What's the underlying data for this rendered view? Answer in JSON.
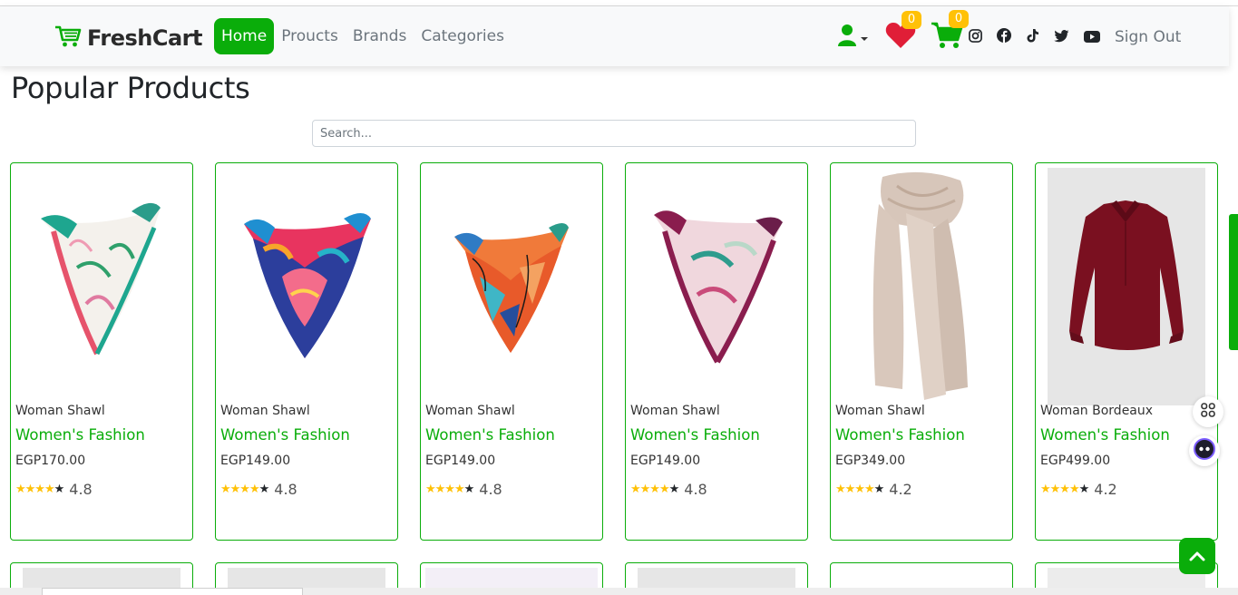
{
  "brand": {
    "name": "FreshCart",
    "accent": "#0aad0a"
  },
  "nav": {
    "links": [
      {
        "label": "Home",
        "active": true
      },
      {
        "label": "Proucts",
        "active": false
      },
      {
        "label": "Brands",
        "active": false
      },
      {
        "label": "Categories",
        "active": false
      }
    ],
    "wishlist_count": "0",
    "cart_count": "0",
    "social_icons": [
      "instagram-icon",
      "facebook-icon",
      "tiktok-icon",
      "twitter-icon",
      "youtube-icon"
    ],
    "signout_label": "Sign Out"
  },
  "page": {
    "title": "Popular Products",
    "search_placeholder": "Search..."
  },
  "products": [
    {
      "name": "Woman Shawl",
      "category": "Women's Fashion",
      "price": "EGP170.00",
      "rating": "4.8",
      "stars": 4
    },
    {
      "name": "Woman Shawl",
      "category": "Women's Fashion",
      "price": "EGP149.00",
      "rating": "4.8",
      "stars": 4
    },
    {
      "name": "Woman Shawl",
      "category": "Women's Fashion",
      "price": "EGP149.00",
      "rating": "4.8",
      "stars": 4
    },
    {
      "name": "Woman Shawl",
      "category": "Women's Fashion",
      "price": "EGP149.00",
      "rating": "4.8",
      "stars": 4
    },
    {
      "name": "Woman Shawl",
      "category": "Women's Fashion",
      "price": "EGP349.00",
      "rating": "4.2",
      "stars": 4
    },
    {
      "name": "Woman Bordeaux",
      "category": "Women's Fashion",
      "price": "EGP499.00",
      "rating": "4.2",
      "stars": 4
    }
  ]
}
